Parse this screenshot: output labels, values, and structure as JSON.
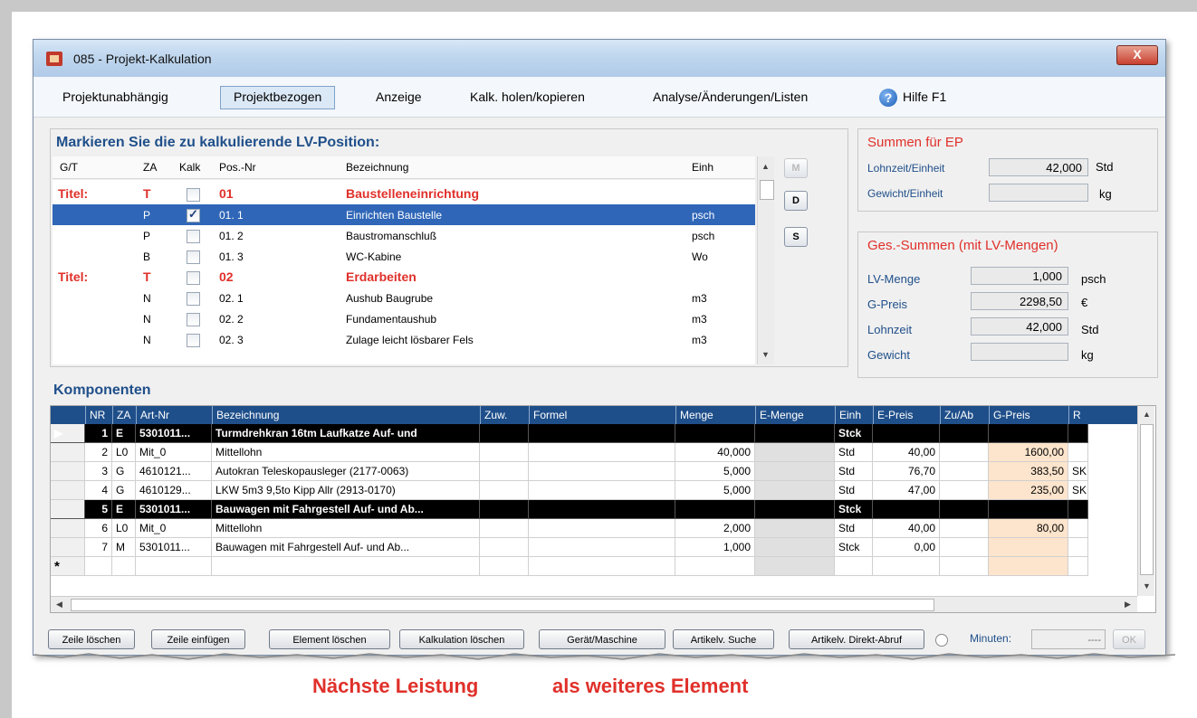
{
  "window": {
    "title": "085  -  Projekt-Kalkulation",
    "close_label": "X"
  },
  "menu": {
    "items": [
      "Projektunabhängig",
      "Projektbezogen",
      "Anzeige",
      "Kalk. holen/kopieren",
      "Analyse/Änderungen/Listen"
    ],
    "active_index": 1,
    "help_label": "Hilfe F1"
  },
  "lv": {
    "heading": "Markieren Sie die zu kalkulierende LV-Position:",
    "columns": [
      "G/T",
      "ZA",
      "Kalk",
      "Pos.-Nr",
      "Bezeichnung",
      "Einh"
    ],
    "rows": [
      {
        "gt": "Titel:",
        "za": "T",
        "kalk": false,
        "pos": "01",
        "bez": "Baustelleneinrichtung",
        "einh": "",
        "title": true,
        "selected": false
      },
      {
        "gt": "",
        "za": "P",
        "kalk": true,
        "pos": "01. 1",
        "bez": "Einrichten Baustelle",
        "einh": "psch",
        "title": false,
        "selected": true
      },
      {
        "gt": "",
        "za": "P",
        "kalk": false,
        "pos": "01. 2",
        "bez": "Baustromanschluß",
        "einh": "psch",
        "title": false,
        "selected": false
      },
      {
        "gt": "",
        "za": "B",
        "kalk": false,
        "pos": "01. 3",
        "bez": "WC-Kabine",
        "einh": "Wo",
        "title": false,
        "selected": false
      },
      {
        "gt": "Titel:",
        "za": "T",
        "kalk": false,
        "pos": "02",
        "bez": "Erdarbeiten",
        "einh": "",
        "title": true,
        "selected": false
      },
      {
        "gt": "",
        "za": "N",
        "kalk": false,
        "pos": "02. 1",
        "bez": "Aushub Baugrube",
        "einh": "m3",
        "title": false,
        "selected": false
      },
      {
        "gt": "",
        "za": "N",
        "kalk": false,
        "pos": "02. 2",
        "bez": "Fundamentaushub",
        "einh": "m3",
        "title": false,
        "selected": false
      },
      {
        "gt": "",
        "za": "N",
        "kalk": false,
        "pos": "02. 3",
        "bez": "Zulage leicht lösbarer Fels",
        "einh": "m3",
        "title": false,
        "selected": false
      }
    ],
    "side_buttons": [
      "M",
      "D",
      "S"
    ]
  },
  "summen_ep": {
    "title": "Summen für EP",
    "lohnzeit_label": "Lohnzeit/Einheit",
    "lohnzeit_value": "42,000",
    "lohnzeit_unit": "Std",
    "gewicht_label": "Gewicht/Einheit",
    "gewicht_value": "",
    "gewicht_unit": "kg"
  },
  "ges_summen": {
    "title": "Ges.-Summen (mit LV-Mengen)",
    "rows": [
      {
        "label": "LV-Menge",
        "value": "1,000",
        "unit": "psch"
      },
      {
        "label": "G-Preis",
        "value": "2298,50",
        "unit": "€"
      },
      {
        "label": "Lohnzeit",
        "value": "42,000",
        "unit": "Std"
      },
      {
        "label": "Gewicht",
        "value": "",
        "unit": "kg"
      }
    ]
  },
  "komponenten": {
    "heading": "Komponenten",
    "columns": [
      "NR",
      "ZA",
      "Art-Nr",
      "Bezeichnung",
      "Zuw.",
      "Formel",
      "Menge",
      "E-Menge",
      "Einh",
      "E-Preis",
      "Zu/Ab",
      "G-Preis",
      "R"
    ],
    "rows": [
      {
        "nr": "1",
        "za": "E",
        "art": "5301011...",
        "bez": "Turmdrehkran 16tm Laufkatze Auf- und",
        "zuw": "",
        "formel": "",
        "menge": "",
        "emenge": "",
        "einh": "Stck",
        "epreis": "",
        "zuab": "",
        "gpreis": "",
        "r": "",
        "black": true,
        "current": true
      },
      {
        "nr": "2",
        "za": "L0",
        "art": "Mit_0",
        "bez": "Mittellohn",
        "zuw": "",
        "formel": "",
        "menge": "40,000",
        "emenge": "",
        "einh": "Std",
        "epreis": "40,00",
        "zuab": "",
        "gpreis": "1600,00",
        "r": "",
        "black": false,
        "current": false
      },
      {
        "nr": "3",
        "za": "G",
        "art": "4610121...",
        "bez": "Autokran Teleskopausleger (2177-0063)",
        "zuw": "",
        "formel": "",
        "menge": "5,000",
        "emenge": "",
        "einh": "Std",
        "epreis": "76,70",
        "zuab": "",
        "gpreis": "383,50",
        "r": "SK",
        "black": false,
        "current": false
      },
      {
        "nr": "4",
        "za": "G",
        "art": "4610129...",
        "bez": "LKW 5m3  9,5to Kipp Allr (2913-0170)",
        "zuw": "",
        "formel": "",
        "menge": "5,000",
        "emenge": "",
        "einh": "Std",
        "epreis": "47,00",
        "zuab": "",
        "gpreis": "235,00",
        "r": "SK",
        "black": false,
        "current": false
      },
      {
        "nr": "5",
        "za": "E",
        "art": "5301011...",
        "bez": "Bauwagen mit Fahrgestell Auf- und Ab...",
        "zuw": "",
        "formel": "",
        "menge": "",
        "emenge": "",
        "einh": "Stck",
        "epreis": "",
        "zuab": "",
        "gpreis": "",
        "r": "",
        "black": true,
        "current": false
      },
      {
        "nr": "6",
        "za": "L0",
        "art": "Mit_0",
        "bez": "Mittellohn",
        "zuw": "",
        "formel": "",
        "menge": "2,000",
        "emenge": "",
        "einh": "Std",
        "epreis": "40,00",
        "zuab": "",
        "gpreis": "80,00",
        "r": "",
        "black": false,
        "current": false
      },
      {
        "nr": "7",
        "za": "M",
        "art": "5301011...",
        "bez": "Bauwagen mit Fahrgestell Auf- und Ab...",
        "zuw": "",
        "formel": "",
        "menge": "1,000",
        "emenge": "",
        "einh": "Stck",
        "epreis": "0,00",
        "zuab": "",
        "gpreis": "",
        "r": "",
        "black": false,
        "current": false
      }
    ],
    "new_row_marker": "*",
    "current_marker": "▶"
  },
  "buttons": {
    "zeile_loeschen": "Zeile löschen",
    "zeile_einfuegen": "Zeile einfügen",
    "element_loeschen": "Element löschen",
    "kalkulation_loeschen": "Kalkulation löschen",
    "geraet": "Gerät/Maschine",
    "artikel_suche": "Artikelv. Suche",
    "artikel_direkt": "Artikelv. Direkt-Abruf",
    "minuten_label": "Minuten:",
    "minuten_value": "----",
    "ok": "OK"
  },
  "caption": {
    "left": "Nächste Leistung",
    "right": "als weiteres Element"
  },
  "colors": {
    "accent_blue": "#1f4f8a",
    "title_red": "#e0302a",
    "selection": "#2f66b7",
    "price_bg": "#fde4cc"
  }
}
